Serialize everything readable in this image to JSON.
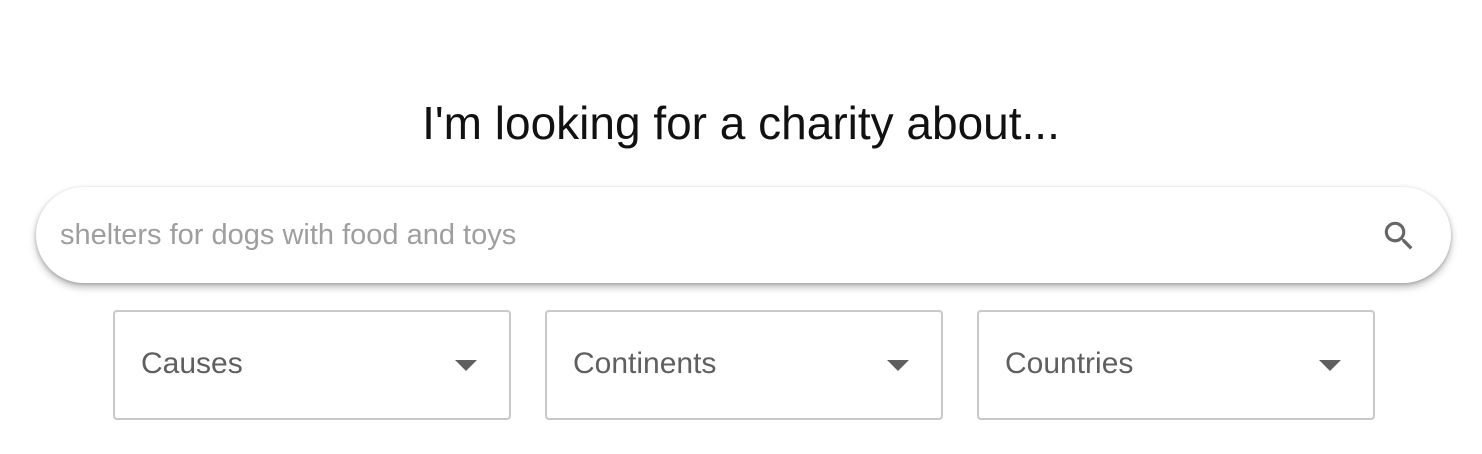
{
  "heading": "I'm looking for a charity about...",
  "search": {
    "placeholder": "shelters for dogs with food and toys",
    "value": "",
    "button_icon": "search-icon"
  },
  "filters": [
    {
      "label": "Causes"
    },
    {
      "label": "Continents"
    },
    {
      "label": "Countries"
    }
  ],
  "colors": {
    "text_heading": "#111111",
    "placeholder": "#9e9e9e",
    "dropdown_text": "#5f5f5f",
    "dropdown_border": "#c8c8c8",
    "icon": "#666666"
  }
}
